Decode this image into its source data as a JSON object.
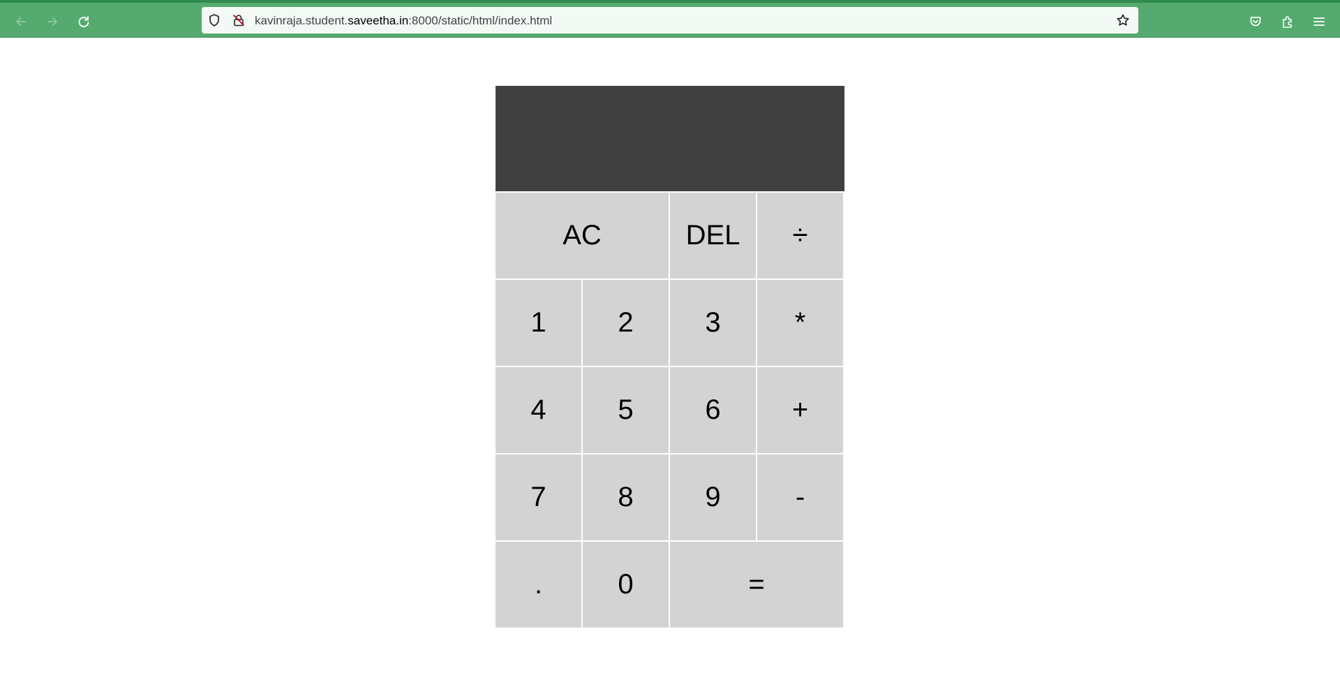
{
  "browser": {
    "url_prefix": "kavinraja.student.",
    "url_host": "saveetha.in",
    "url_suffix": ":8000/static/html/index.html",
    "icons": [
      "back-arrow-icon",
      "forward-arrow-icon",
      "reload-icon",
      "shield-icon",
      "insecure-lock-icon",
      "bookmark-star-icon",
      "pocket-icon",
      "extensions-icon",
      "menu-icon"
    ],
    "colors": {
      "toolbar": "#55ab6f",
      "urlbar": "#f3faf5"
    }
  },
  "calculator": {
    "display_value": "",
    "keys": {
      "ac": "AC",
      "del": "DEL",
      "divide": "÷",
      "one": "1",
      "two": "2",
      "three": "3",
      "multiply": "*",
      "four": "4",
      "five": "5",
      "six": "6",
      "plus": "+",
      "seven": "7",
      "eight": "8",
      "nine": "9",
      "minus": "-",
      "decimal": ".",
      "zero": "0",
      "equals": "="
    },
    "colors": {
      "display": "#404040",
      "key": "#d3d3d3",
      "gap": "#ffffff"
    }
  }
}
